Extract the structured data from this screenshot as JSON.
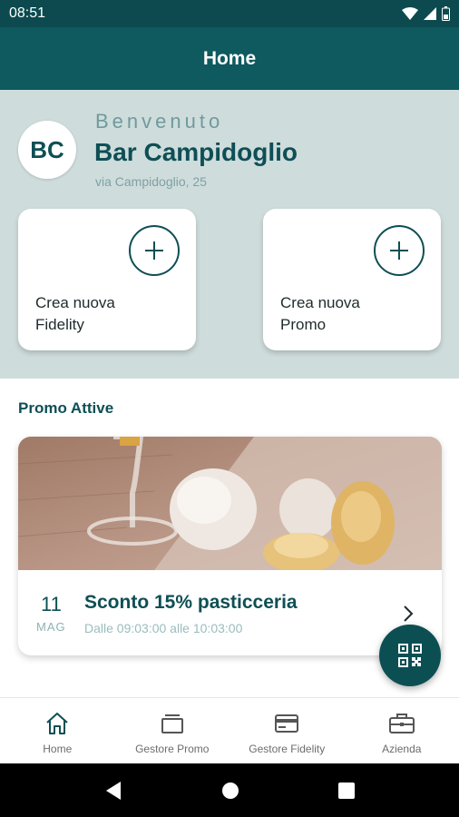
{
  "status_bar": {
    "time": "08:51"
  },
  "app_bar": {
    "title": "Home"
  },
  "header": {
    "avatar_initials": "BC",
    "welcome": "Benvenuto",
    "business_name": "Bar Campidoglio",
    "address": "via Campidoglio, 25"
  },
  "actions": [
    {
      "label": "Crea nuova\nFidelity",
      "icon": "plus-icon"
    },
    {
      "label": "Crea nuova\nPromo",
      "icon": "plus-icon"
    }
  ],
  "promo_section": {
    "title": "Promo Attive",
    "items": [
      {
        "day": "11",
        "month": "MAG",
        "title": "Sconto 15% pasticceria",
        "time": "Dalle 09:03:00 alle 10:03:00"
      }
    ]
  },
  "fab": {
    "icon": "qr-code-icon"
  },
  "bottom_nav": [
    {
      "label": "Home",
      "icon": "home-icon"
    },
    {
      "label": "Gestore Promo",
      "icon": "promo-icon"
    },
    {
      "label": "Gestore Fidelity",
      "icon": "card-icon"
    },
    {
      "label": "Azienda",
      "icon": "briefcase-icon"
    }
  ],
  "colors": {
    "primary": "#0e5a5f",
    "status_bar": "#0c4a4f",
    "header_bg": "#cfdcdc",
    "accent_text": "#0e4f55"
  }
}
